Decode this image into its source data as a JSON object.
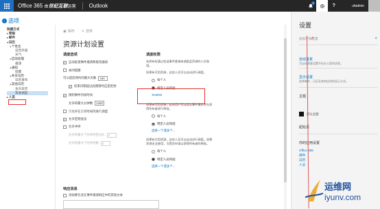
{
  "topbar": {
    "brand": "Office 365",
    "brand_small": "由",
    "brand_partner": "世纪互联",
    "brand_suffix": "运营",
    "app_name": "Outlook",
    "notification_count": "1",
    "username": "ufadmin"
  },
  "nav": {
    "options_title": "选项",
    "items": [
      {
        "label": "快捷方式",
        "level": 0,
        "expand": ""
      },
      {
        "label": "常规",
        "level": 0,
        "expand": "▸"
      },
      {
        "label": "邮件",
        "level": 0,
        "expand": "▸"
      },
      {
        "label": "日历",
        "level": 0,
        "expand": "◂"
      },
      {
        "label": "个性化",
        "level": 1,
        "expand": "◂"
      },
      {
        "label": "日历外观",
        "level": 2,
        "expand": ""
      },
      {
        "label": "天气",
        "level": 2,
        "expand": ""
      },
      {
        "label": "自动处理",
        "level": 1,
        "expand": "◂"
      },
      {
        "label": "邀请",
        "level": 2,
        "expand": ""
      },
      {
        "label": "通知",
        "level": 1,
        "expand": "◂"
      },
      {
        "label": "提醒",
        "level": 2,
        "expand": ""
      },
      {
        "label": "共享日历",
        "level": 1,
        "expand": "◂"
      },
      {
        "label": "日历发布",
        "level": 2,
        "expand": ""
      },
      {
        "label": "其他日历",
        "level": 1,
        "expand": "◂"
      },
      {
        "label": "生日日历",
        "level": 2,
        "expand": ""
      },
      {
        "label": "资源调度",
        "level": 2,
        "expand": "",
        "selected": true
      },
      {
        "label": "人员",
        "level": 0,
        "expand": "▸"
      }
    ]
  },
  "toolbar": {
    "save_label": "保存",
    "discard_label": "放弃"
  },
  "page_title": "资源计划设置",
  "scheduling": {
    "heading": "调度选项",
    "auto_process": "自动处理事件邀请和取消通知",
    "close_reminders": "关闭提醒",
    "max_days_label": "可以提前预约的最大天数",
    "max_days_value": "180",
    "end_date_reject": "结束日期超过此期限时应是拒绝",
    "limit_duration": "限制事件持续时间",
    "max_minutes_label": "允许的最大分钟数",
    "max_minutes_value": "1440",
    "work_hours_only": "只允许在工作时间内进行调度",
    "allow_recurring": "允许定期会议",
    "allow_conflicts": "允许冲突",
    "max_conflict_pct_label": "允许的最大个别冲突百分比",
    "max_conflict_pct_value": "0",
    "max_conflict_count_label": "允许的最大个别冲突数",
    "max_conflict_count_value": "0"
  },
  "permissions": {
    "heading": "调度权限",
    "intro": "选择有权通过发送事件邀请来调度此资源的人员和组。",
    "group1_desc": "如果有可用资源，这些人员可以自动进行调度。",
    "group1_opt_everyone": "每个人",
    "group1_opt_specific": "特定人员和组:",
    "group1_member": "Test002",
    "group2_desc": "如果有可用资源，这些用户可以提交事件请求并在获得所有者进行审批。",
    "group2_opt_everyone": "每个人",
    "group2_opt_specific": "特定人员和组:",
    "group2_link": "选择一个或多个...",
    "group3_desc": "如果有可用资源，这些人员可以自动进行调度。如果资源无法使用，可提交申请以获得所有者的审批。",
    "group3_opt_everyone": "每个人",
    "group3_opt_specific": "特定人员和组:",
    "group3_link": "选择一个或多个..."
  },
  "response": {
    "heading": "响应消息",
    "add_text": "添加要包含在事件邀请响应中的其他文本"
  },
  "settings": {
    "title": "设置",
    "search_placeholder": "搜索所有设置",
    "auto_reply": "自动答复",
    "auto_reply_desc": "为自动答复设置不在办公室的消息。",
    "display": "显示设置",
    "display_desc": "选择邮件、日历及其他应用的显示方式。",
    "theme": "主题",
    "theme_value": "默认主题",
    "start_page": "起始页",
    "your_apps": "你的应用设置",
    "apps": [
      "Office 365",
      "邮件",
      "日历",
      "人员"
    ]
  },
  "watermark": {
    "line1": "运维网",
    "line2": "iyunv.com"
  }
}
